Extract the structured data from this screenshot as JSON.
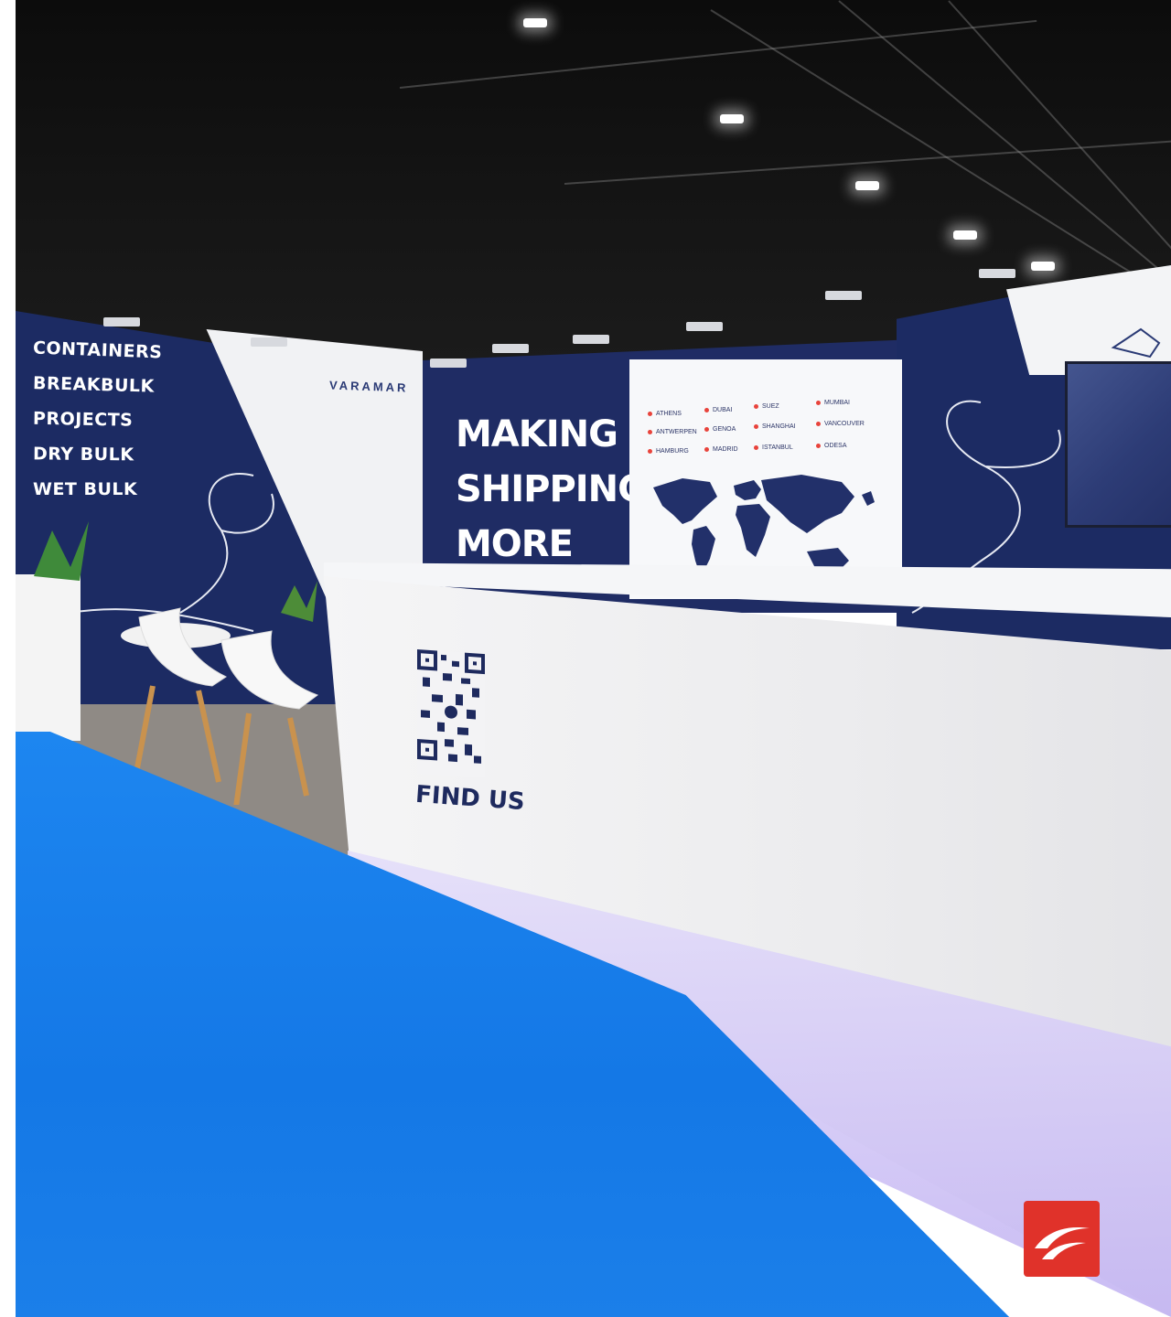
{
  "colors": {
    "wall_navy": "#1c2b63",
    "carpet_blue": "#1478e6",
    "accent_red": "#e8433b",
    "counter_white": "#f5f5f6",
    "logo_red": "#e0322a"
  },
  "booth": {
    "services": [
      "CONTAINERS",
      "BREAKBULK",
      "PROJECTS",
      "DRY BULK",
      "WET BULK"
    ],
    "brand_name": "VARAMAR",
    "slogan": [
      "MAKING",
      "SHIPPING",
      "MORE"
    ],
    "offices": [
      "ATHENS",
      "DUBAI",
      "SUEZ",
      "MUMBAI",
      "ANTWERPEN",
      "GENOA",
      "SHANGHAI",
      "VANCOUVER",
      "HAMBURG",
      "MADRID",
      "ISTANBUL",
      "ODESA"
    ]
  },
  "counter": {
    "call_to_action": "FIND US"
  },
  "icons": {
    "qr_code": "qr-code-icon",
    "corner_logo": "swoosh-logo-icon"
  }
}
